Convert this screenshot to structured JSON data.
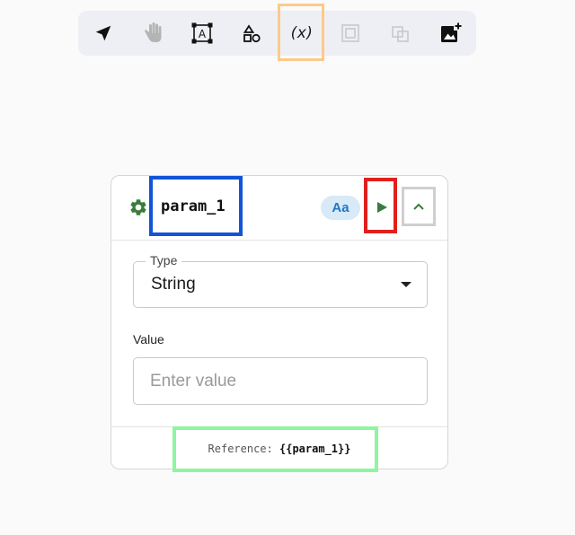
{
  "toolbar": {
    "tools": [
      {
        "name": "select",
        "icon": "navigation-arrow-icon"
      },
      {
        "name": "pan",
        "icon": "hand-icon"
      },
      {
        "name": "text",
        "icon": "text-box-icon",
        "glyph": "A"
      },
      {
        "name": "shapes",
        "icon": "shapes-icon"
      },
      {
        "name": "variable",
        "icon": "variable-icon",
        "label": "(x)",
        "state": "highlighted"
      },
      {
        "name": "group",
        "icon": "group-icon",
        "state": "disabled"
      },
      {
        "name": "ungroup",
        "icon": "ungroup-icon",
        "state": "disabled"
      },
      {
        "name": "add-image",
        "icon": "add-image-icon"
      }
    ]
  },
  "param_card": {
    "name": "param_1",
    "type_badge": "Aa",
    "settings_icon": "gear-icon",
    "run_icon": "play-icon",
    "collapse_icon": "chevron-up-icon",
    "type_field": {
      "label": "Type",
      "value": "String"
    },
    "value_field": {
      "label": "Value",
      "placeholder": "Enter value",
      "value": ""
    },
    "reference": {
      "label": "Reference:",
      "value": "{{param_1}}"
    }
  },
  "colors": {
    "accent_green": "#3a7d3a",
    "badge_bg": "#d8e9f8",
    "badge_text": "#1f77c9",
    "highlight_orange": "#fcc98c",
    "highlight_blue": "#1254d6",
    "highlight_red": "#e0201c",
    "highlight_gray": "#cfcfcf",
    "highlight_green": "#90f5a0"
  }
}
